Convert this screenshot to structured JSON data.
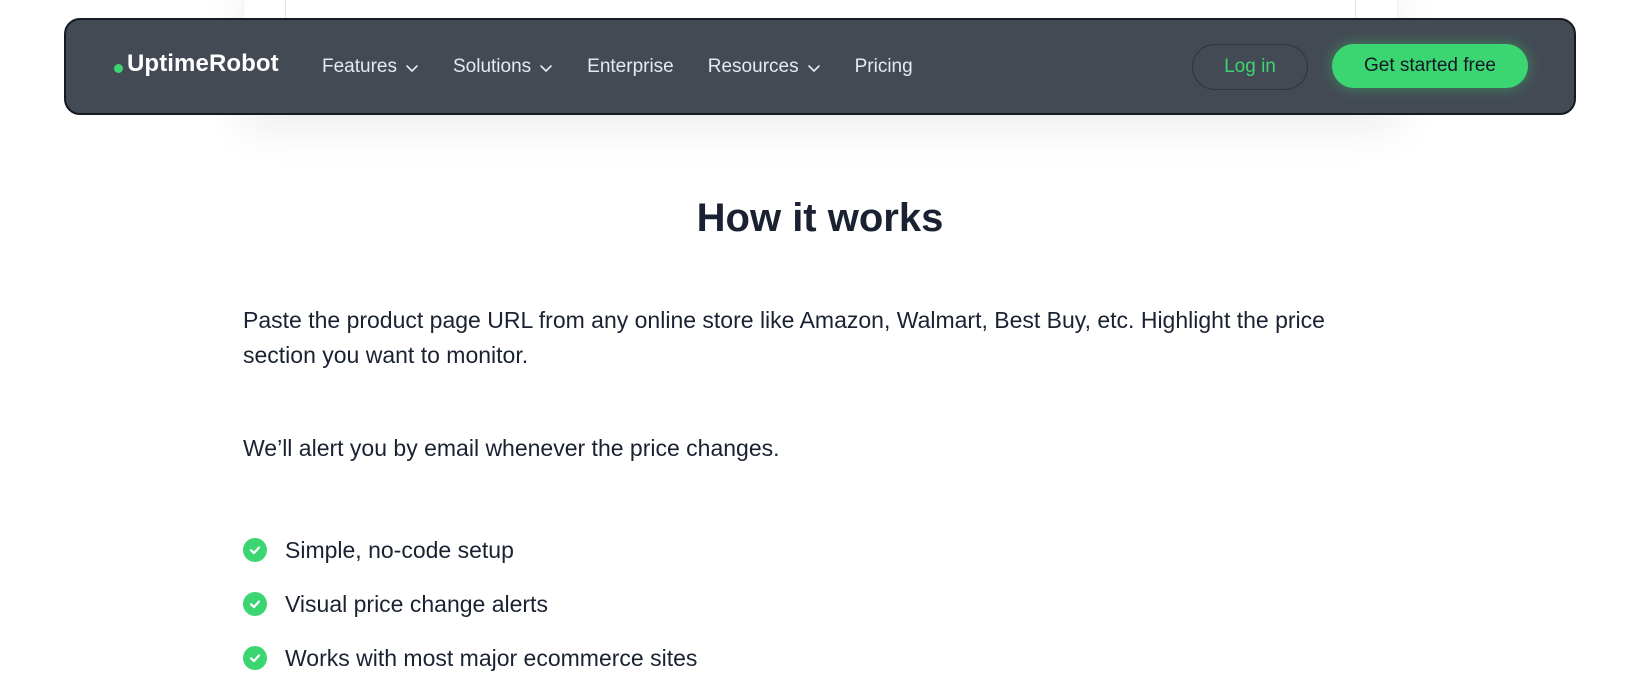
{
  "brand": {
    "name": "UptimeRobot",
    "accent_color": "#3bd671"
  },
  "nav": {
    "items": [
      {
        "label": "Features",
        "dropdown": true
      },
      {
        "label": "Solutions",
        "dropdown": true
      },
      {
        "label": "Enterprise",
        "dropdown": false
      },
      {
        "label": "Resources",
        "dropdown": true
      },
      {
        "label": "Pricing",
        "dropdown": false
      }
    ],
    "login_label": "Log in",
    "cta_label": "Get started free"
  },
  "main": {
    "title": "How it works",
    "paragraph_1": "Paste the product page URL from any online store like Amazon, Walmart, Best Buy, etc. Highlight the price section you want to monitor.",
    "paragraph_2": "We’ll alert you by email whenever the price changes.",
    "features": [
      {
        "label": "Simple, no-code setup",
        "icon": "check-circle-icon"
      },
      {
        "label": "Visual price change alerts",
        "icon": "check-circle-icon"
      },
      {
        "label": "Works with most major ecommerce sites",
        "icon": "check-circle-icon"
      }
    ]
  }
}
